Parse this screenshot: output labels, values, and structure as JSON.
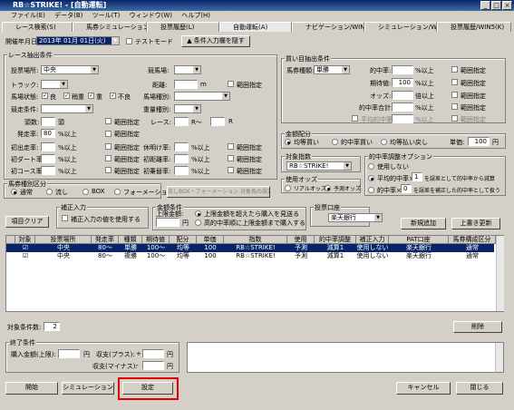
{
  "window": {
    "title": "RB☆STRIKE! - [自動運転]",
    "min": "_",
    "max": "□",
    "close": "×"
  },
  "menu": [
    "ファイル(E)",
    "データ(B)",
    "ツール(T)",
    "ウィンドウ(W)",
    "ヘルプ(H)"
  ],
  "tabs": [
    "レース検索(S)",
    "馬券シミュレーション(B)",
    "投票履歴(L)",
    "自動運転(A)",
    "ナビゲーション/WIN5(N)",
    "シミュレーション/WIN5(J)",
    "投票履歴/WIN5(K)"
  ],
  "top": {
    "date_label": "開催年月日:",
    "date_value": "2013年 01月 01日(火)",
    "test_mode": "テストモード",
    "save_btn": "▲ 条件入力欄を隠す"
  },
  "race": {
    "group": "レース抽出条件",
    "place_label": "投票場所:",
    "place_value": "中央",
    "track_label": "トラック:",
    "cond_label": "馬場状態:",
    "cond_items": [
      "良",
      "稍重",
      "重",
      "不良"
    ],
    "race_cond_label": "競走条件:",
    "age_label": "頭数:",
    "age_unit": "頭",
    "odds_label": "発走率:",
    "odds_value": "80",
    "odds_unit": "%以上",
    "w1_label": "初出走率:",
    "w2_label": "初ダート率:",
    "w3_label": "初コース率:",
    "pct_over": "%以上",
    "name_label": "競馬場:",
    "dist_label": "距離:",
    "dist_unit": "m",
    "range": "範囲指定",
    "type_label": "馬場種別:",
    "weight_label": "重量種別:",
    "race_label": "レース:",
    "race_r1": "R〜",
    "race_r2": "R",
    "rest_label": "休明け率:",
    "jump_label": "初距離率:",
    "change_label": "初乗替率:"
  },
  "buy": {
    "group": "馬券種別区分",
    "opts": [
      "通常",
      "流し",
      "BOX",
      "フォーメーション"
    ],
    "formation_btn": "流しBOX・フォーメーション 対象馬の設定"
  },
  "clear_btn": "項目クリア",
  "fix": {
    "group": "補正入力",
    "check": "補正入力の値を使用する"
  },
  "money": {
    "group": "金額条件",
    "upper": "上限金額:",
    "yen": "円",
    "r1": "上限金額を超えたら購入を見送る",
    "r2": "高的中率順に上限金額まで購入する"
  },
  "bet": {
    "group": "投票口座",
    "value": "楽天銀行"
  },
  "newadd_btn": "新規追加",
  "update_btn": "上書き更新",
  "buycond": {
    "group": "買い目抽出条件",
    "type_label": "馬券種類:",
    "type_value": "単勝",
    "hit_label": "的中率:",
    "hit_unit": "%以上",
    "rec_label": "期待値:",
    "rec_value": "100",
    "rec_unit": "%以上",
    "odds_label": "オッズ:",
    "odds_unit": "倍以上",
    "hitsum_label": "的中率合計:",
    "avg_label": "平均的中率",
    "range": "範囲指定"
  },
  "alloc": {
    "group": "金額配分",
    "r": [
      "均等買い",
      "的中率買い",
      "均等払い戻し"
    ],
    "unit_label": "単価:",
    "unit_value": "100",
    "unit_yen": "円"
  },
  "index": {
    "group": "対象指数",
    "value": "RB☆STRIKE!",
    "odds_group": "使用オッズ",
    "o1": "リアルオッズ",
    "o2": "予測オッズ"
  },
  "hitopt": {
    "group": "的中率調整オプション",
    "o1": "使用しない",
    "o2": "平均的中率×",
    "o2v": "1",
    "o2t": "を誤差として的中率から減算",
    "o3": "的中率×",
    "o3v": "0",
    "o3t": "を誤差を補正した的中率として扱う"
  },
  "grid": {
    "headers": [
      "対象",
      "投票場所",
      "発走率",
      "種類",
      "期待値",
      "配分",
      "単価",
      "指数",
      "使用",
      "的中率調整",
      "補正入力",
      "PAT口座",
      "馬券構成区分"
    ],
    "rows": [
      [
        "☑",
        "中央",
        "80〜",
        "単勝",
        "100〜",
        "均等",
        "100",
        "RB☆STRIKE!",
        "予測",
        "減算1",
        "使用しない",
        "楽天銀行",
        "通常"
      ],
      [
        "☑",
        "中央",
        "80〜",
        "複勝",
        "100〜",
        "均等",
        "100",
        "RB☆STRIKE!",
        "予測",
        "減算1",
        "使用しない",
        "楽天銀行",
        "通常"
      ]
    ]
  },
  "count_label": "対象条件数:",
  "count_value": "2",
  "delete_btn": "削除",
  "end": {
    "group": "終了条件",
    "buy_label": "購入金額(上限):",
    "yen": "円",
    "plus_label": "収支(プラス):",
    "minus_label": "収支(マイナス):",
    "plus": "+",
    "minus": "-"
  },
  "footer": {
    "start": "開始",
    "sim": "シミュレーション",
    "set": "設定",
    "cancel": "キャンセル",
    "close": "閉じる"
  }
}
